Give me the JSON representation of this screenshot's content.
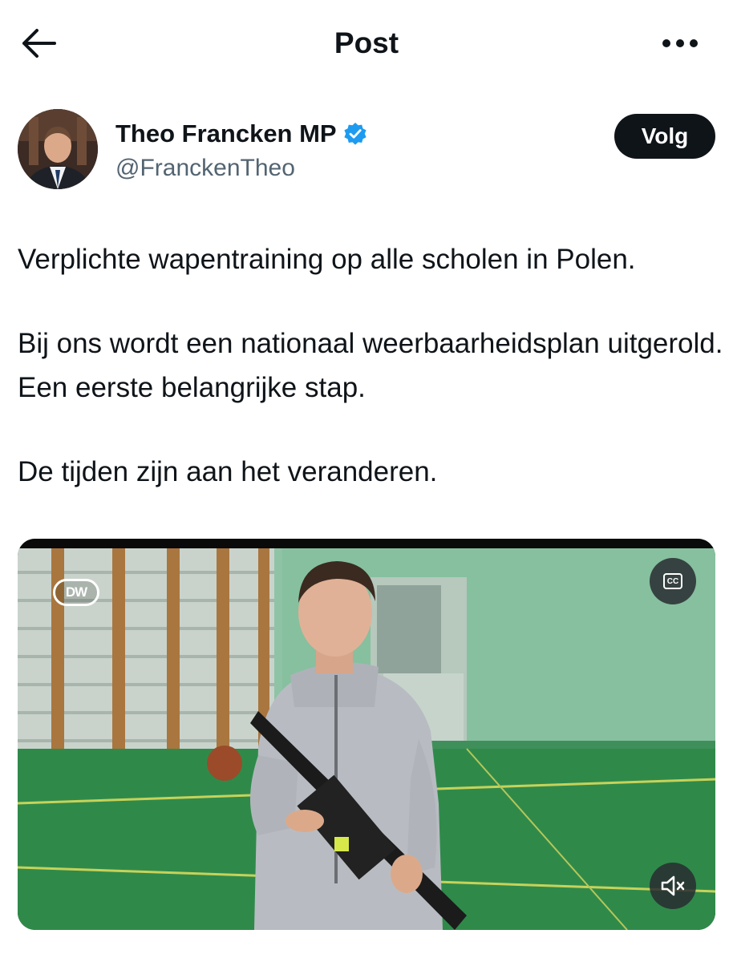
{
  "header": {
    "title": "Post",
    "back_icon": "arrow-left-icon",
    "more_icon": "more-horizontal-icon"
  },
  "author": {
    "name": "Theo Francken MP",
    "handle": "@FranckenTheo",
    "verified": true,
    "follow_label": "Volg"
  },
  "tweet": {
    "paragraphs": [
      "Verplichte wapentraining op alle scholen in Polen.",
      "Bij ons wordt een nationaal weerbaarheidsplan uitgerold. Een eerste belangrijke stap.",
      "De tijden zijn aan het veranderen."
    ]
  },
  "media": {
    "type": "video",
    "watermark": "DW",
    "captions_label": "CC",
    "captions_icon": "closed-captions-icon",
    "mute_icon": "speaker-muted-icon"
  },
  "colors": {
    "text": "#0f1419",
    "secondary": "#536471",
    "verified_blue": "#1d9bf0",
    "follow_bg": "#0f1419"
  }
}
